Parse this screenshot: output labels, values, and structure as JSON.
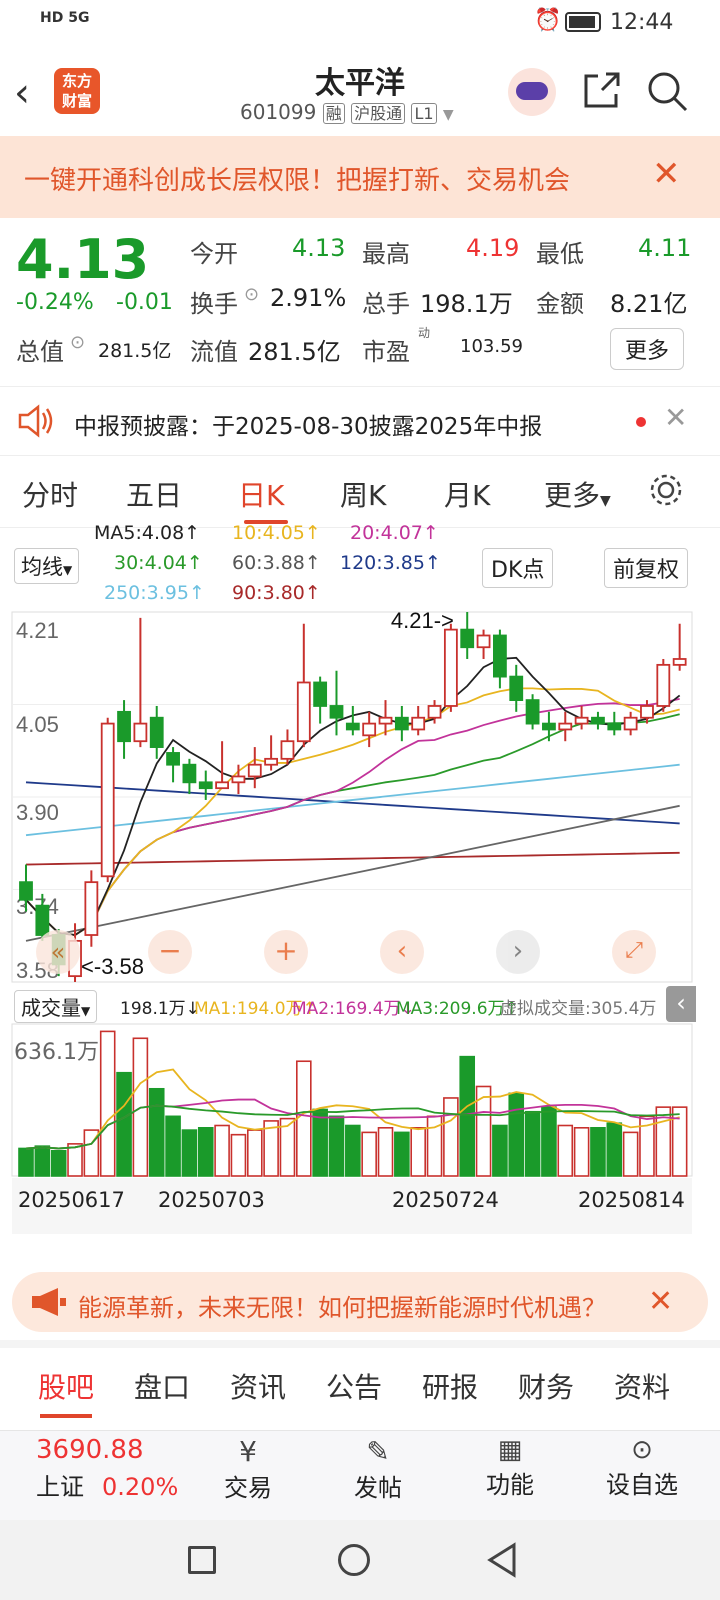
{
  "status": {
    "left": "HD 5G",
    "time": "12:44"
  },
  "nav": {
    "title": "太平洋",
    "code": "601099",
    "tags": [
      "融",
      "沪股通",
      "L1"
    ],
    "logo": [
      "东方",
      "财富"
    ]
  },
  "banner": {
    "text": "一键开通科创成长层权限！把握打新、交易机会"
  },
  "quote": {
    "price": "4.13",
    "change_pct": "-0.24%",
    "change": "-0.01",
    "open_label": "今开",
    "open": "4.13",
    "high_label": "最高",
    "high": "4.19",
    "low_label": "最低",
    "low": "4.11",
    "turnover_label": "换手",
    "turnover": "2.91%",
    "volume_label": "总手",
    "volume": "198.1万",
    "amount_label": "金额",
    "amount": "8.21亿",
    "mktcap_label": "总值",
    "mktcap": "281.5亿",
    "float_label": "流值",
    "float": "281.5亿",
    "pe_label": "市盈",
    "pe_sup": "动",
    "pe": "103.59",
    "more": "更多"
  },
  "notice": {
    "text": "中报预披露：于2025-08-30披露2025年中报"
  },
  "tabs": [
    "分时",
    "五日",
    "日K",
    "周K",
    "月K",
    "更多"
  ],
  "ma_legend": {
    "ma5": "MA5:4.08↑",
    "ma10": "10:4.05↑",
    "ma20": "20:4.07↑",
    "ma30": "30:4.04↑",
    "ma60": "60:3.88↑",
    "ma120": "120:3.85↑",
    "ma250": "250:3.95↑",
    "ma90": "90:3.80↑",
    "select": "均线",
    "dk": "DK点",
    "fq": "前复权"
  },
  "colors": {
    "up": "#c8312d",
    "down": "#1a9a2a",
    "ma5": "#222222",
    "ma10": "#e8b520",
    "ma20": "#c2339a",
    "ma30": "#2a9a2a",
    "ma60": "#666666",
    "ma120": "#1f3a8a",
    "ma250": "#6cc0e0",
    "ma90": "#a82a2a"
  },
  "volume_legend": {
    "select": "成交量",
    "val": "198.1万↓",
    "ma1": "MA1:194.0万↑",
    "ma2": "MA2:169.4万↓",
    "ma3": "MA3:209.6万↑",
    "virtual": "虚拟成交量:305.4万",
    "max": "636.1万"
  },
  "dates": [
    "20250617",
    "20250703",
    "20250724",
    "20250814"
  ],
  "chart_data": {
    "type": "candlestick",
    "y_ticks": [
      "4.21",
      "4.05",
      "3.90",
      "3.74",
      "3.58"
    ],
    "ylim": [
      3.58,
      4.21
    ],
    "annotations": [
      "4.21->",
      "<-3.58"
    ],
    "candles": [
      [
        3.75,
        3.72,
        3.78,
        3.7
      ],
      [
        3.71,
        3.66,
        3.73,
        3.65
      ],
      [
        3.66,
        3.61,
        3.67,
        3.59
      ],
      [
        3.59,
        3.65,
        3.68,
        3.58
      ],
      [
        3.66,
        3.75,
        3.77,
        3.64
      ],
      [
        3.76,
        4.02,
        4.03,
        3.75
      ],
      [
        4.04,
        3.99,
        4.06,
        3.96
      ],
      [
        3.99,
        4.02,
        4.2,
        3.98
      ],
      [
        4.03,
        3.98,
        4.05,
        3.96
      ],
      [
        3.97,
        3.95,
        3.98,
        3.92
      ],
      [
        3.95,
        3.92,
        3.96,
        3.9
      ],
      [
        3.92,
        3.91,
        3.94,
        3.89
      ],
      [
        3.91,
        3.92,
        3.99,
        3.91
      ],
      [
        3.92,
        3.93,
        3.95,
        3.9
      ],
      [
        3.93,
        3.95,
        3.98,
        3.91
      ],
      [
        3.95,
        3.96,
        4.0,
        3.94
      ],
      [
        3.96,
        3.99,
        4.01,
        3.95
      ],
      [
        3.99,
        4.09,
        4.19,
        3.98
      ],
      [
        4.09,
        4.05,
        4.1,
        4.02
      ],
      [
        4.05,
        4.03,
        4.11,
        4.0
      ],
      [
        4.02,
        4.01,
        4.05,
        4.0
      ],
      [
        4.0,
        4.02,
        4.04,
        3.98
      ],
      [
        4.02,
        4.03,
        4.06,
        4.0
      ],
      [
        4.03,
        4.01,
        4.05,
        3.99
      ],
      [
        4.01,
        4.03,
        4.05,
        4.0
      ],
      [
        4.03,
        4.05,
        4.06,
        4.02
      ],
      [
        4.05,
        4.18,
        4.19,
        4.04
      ],
      [
        4.18,
        4.15,
        4.21,
        4.13
      ],
      [
        4.15,
        4.17,
        4.18,
        4.13
      ],
      [
        4.17,
        4.1,
        4.18,
        4.08
      ],
      [
        4.1,
        4.06,
        4.12,
        4.04
      ],
      [
        4.06,
        4.02,
        4.07,
        4.01
      ],
      [
        4.02,
        4.01,
        4.04,
        3.99
      ],
      [
        4.01,
        4.02,
        4.04,
        3.99
      ],
      [
        4.02,
        4.03,
        4.05,
        4.01
      ],
      [
        4.03,
        4.02,
        4.04,
        4.01
      ],
      [
        4.02,
        4.01,
        4.04,
        4.0
      ],
      [
        4.01,
        4.03,
        4.04,
        4.0
      ],
      [
        4.03,
        4.05,
        4.06,
        4.02
      ],
      [
        4.05,
        4.12,
        4.13,
        4.04
      ],
      [
        4.12,
        4.13,
        4.19,
        4.11
      ]
    ],
    "volume": [
      1.2,
      1.3,
      1.1,
      1.4,
      2.0,
      6.3,
      4.5,
      6.0,
      3.8,
      2.6,
      2.0,
      2.1,
      2.2,
      1.8,
      2.0,
      2.4,
      2.5,
      5.0,
      2.9,
      2.6,
      2.2,
      1.9,
      2.1,
      1.9,
      2.1,
      2.6,
      3.4,
      5.2,
      3.9,
      2.2,
      3.6,
      2.8,
      3.0,
      2.2,
      2.1,
      2.1,
      2.3,
      1.9,
      2.6,
      3.0,
      3.0
    ]
  },
  "adbar": {
    "text": "能源革新，未来无限！如何把握新能源时代机遇？"
  },
  "bottom_tabs": [
    "股吧",
    "盘口",
    "资讯",
    "公告",
    "研报",
    "财务",
    "资料"
  ],
  "bottombar": {
    "index_value": "3690.88",
    "index_name": "上证",
    "index_pct": "0.20%",
    "items": [
      "交易",
      "发帖",
      "功能",
      "设自选"
    ]
  }
}
